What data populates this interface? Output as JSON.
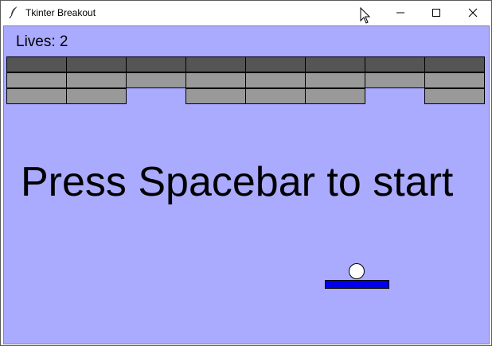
{
  "window": {
    "title": "Tkinter Breakout",
    "icons": {
      "app": "feather-icon",
      "minimize": "minimize-icon",
      "maximize": "maximize-icon",
      "close": "close-icon",
      "cursor": "mouse-pointer-icon"
    }
  },
  "game": {
    "lives_text": "Lives: 2",
    "message": "Press Spacebar to start",
    "colors": {
      "background": "#aaaaff",
      "brick_strong": "#555555",
      "brick_weak": "#999999",
      "paddle": "#0000ee",
      "ball": "#ffffff"
    },
    "brick_rows": [
      [
        "strong",
        "strong",
        "strong",
        "strong",
        "strong",
        "strong",
        "strong",
        "strong"
      ],
      [
        "weak",
        "weak",
        "weak",
        "weak",
        "weak",
        "weak",
        "weak",
        "weak"
      ],
      [
        "weak",
        "weak",
        null,
        "weak",
        "weak",
        "weak",
        null,
        "weak"
      ]
    ]
  }
}
